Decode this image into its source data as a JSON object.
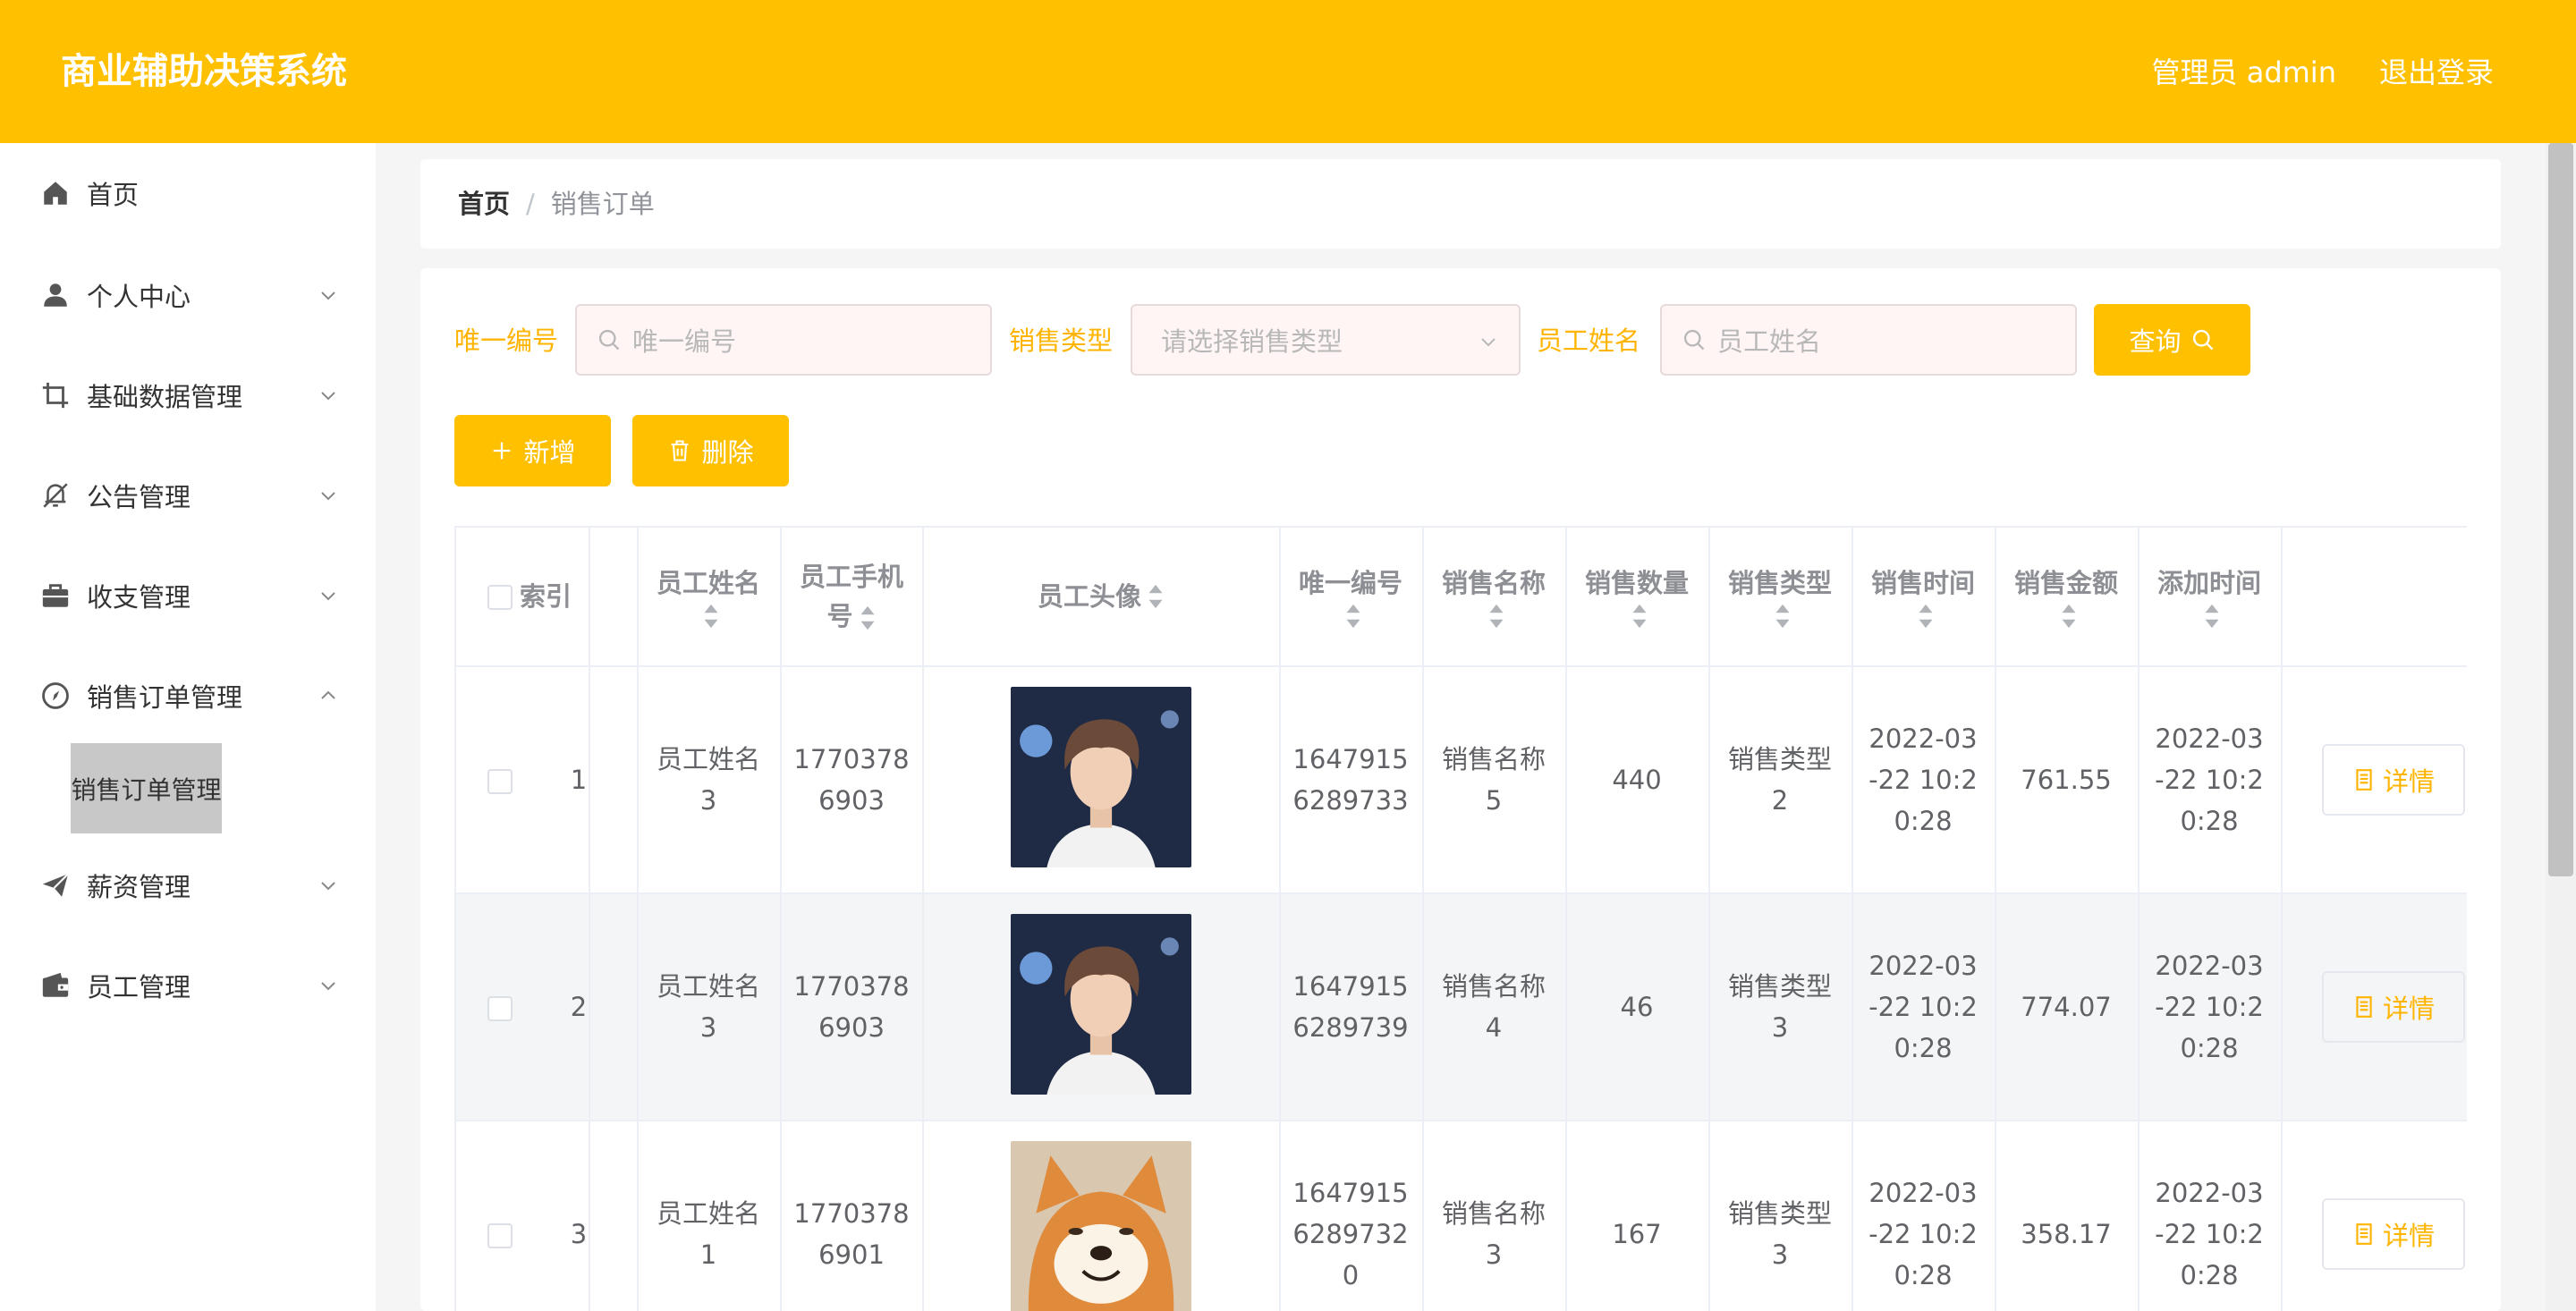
{
  "header": {
    "title": "商业辅助决策系统",
    "user": "管理员 admin",
    "logout": "退出登录"
  },
  "sidebar": {
    "items": [
      {
        "label": "首页",
        "icon": "home-icon"
      },
      {
        "label": "个人中心",
        "icon": "user-icon"
      },
      {
        "label": "基础数据管理",
        "icon": "crop-icon"
      },
      {
        "label": "公告管理",
        "icon": "bell-off-icon"
      },
      {
        "label": "收支管理",
        "icon": "briefcase-icon"
      },
      {
        "label": "销售订单管理",
        "icon": "compass-icon"
      },
      {
        "label": "薪资管理",
        "icon": "send-icon"
      },
      {
        "label": "员工管理",
        "icon": "wallet-icon"
      }
    ],
    "active_sub": "销售订单管理"
  },
  "breadcrumb": {
    "home": "首页",
    "separator": "/",
    "current": "销售订单"
  },
  "search": {
    "unique_label": "唯一编号",
    "unique_placeholder": "唯一编号",
    "type_label": "销售类型",
    "type_placeholder": "请选择销售类型",
    "name_label": "员工姓名",
    "name_placeholder": "员工姓名",
    "query_button": "查询"
  },
  "actions": {
    "add": "新增",
    "delete": "删除"
  },
  "table": {
    "headers": {
      "index": "索引",
      "name": "员工姓名",
      "phone_1": "员工手机",
      "phone_2": "号",
      "avatar": "员工头像",
      "unique": "唯一编号",
      "sale_name": "销售名称",
      "quantity": "销售数量",
      "sale_type": "销售类型",
      "sale_time": "销售时间",
      "amount": "销售金额",
      "added": "添加时间"
    },
    "detail_label": "详情",
    "rows": [
      {
        "index": "1",
        "name_1": "员工姓名",
        "name_2": "3",
        "phone_1": "1770378",
        "phone_2": "6903",
        "avatar": "person",
        "unique_1": "1647915",
        "unique_2": "6289733",
        "unique_3": "",
        "sale_name_1": "销售名称",
        "sale_name_2": "5",
        "quantity": "440",
        "sale_type_1": "销售类型",
        "sale_type_2": "2",
        "time_1": "2022-03",
        "time_2": "-22 10:2",
        "time_3": "0:28",
        "amount": "761.55",
        "added_1": "2022-03",
        "added_2": "-22 10:2",
        "added_3": "0:28"
      },
      {
        "index": "2",
        "name_1": "员工姓名",
        "name_2": "3",
        "phone_1": "1770378",
        "phone_2": "6903",
        "avatar": "person",
        "unique_1": "1647915",
        "unique_2": "6289739",
        "unique_3": "",
        "sale_name_1": "销售名称",
        "sale_name_2": "4",
        "quantity": "46",
        "sale_type_1": "销售类型",
        "sale_type_2": "3",
        "time_1": "2022-03",
        "time_2": "-22 10:2",
        "time_3": "0:28",
        "amount": "774.07",
        "added_1": "2022-03",
        "added_2": "-22 10:2",
        "added_3": "0:28"
      },
      {
        "index": "3",
        "name_1": "员工姓名",
        "name_2": "1",
        "phone_1": "1770378",
        "phone_2": "6901",
        "avatar": "dog",
        "unique_1": "1647915",
        "unique_2": "6289732",
        "unique_3": "0",
        "sale_name_1": "销售名称",
        "sale_name_2": "3",
        "quantity": "167",
        "sale_type_1": "销售类型",
        "sale_type_2": "3",
        "time_1": "2022-03",
        "time_2": "-22 10:2",
        "time_3": "0:28",
        "amount": "358.17",
        "added_1": "2022-03",
        "added_2": "-22 10:2",
        "added_3": "0:28"
      }
    ]
  },
  "colors": {
    "accent": "#ffc000",
    "label": "#ffb400",
    "sidebar_active": "#c8c8c8"
  }
}
